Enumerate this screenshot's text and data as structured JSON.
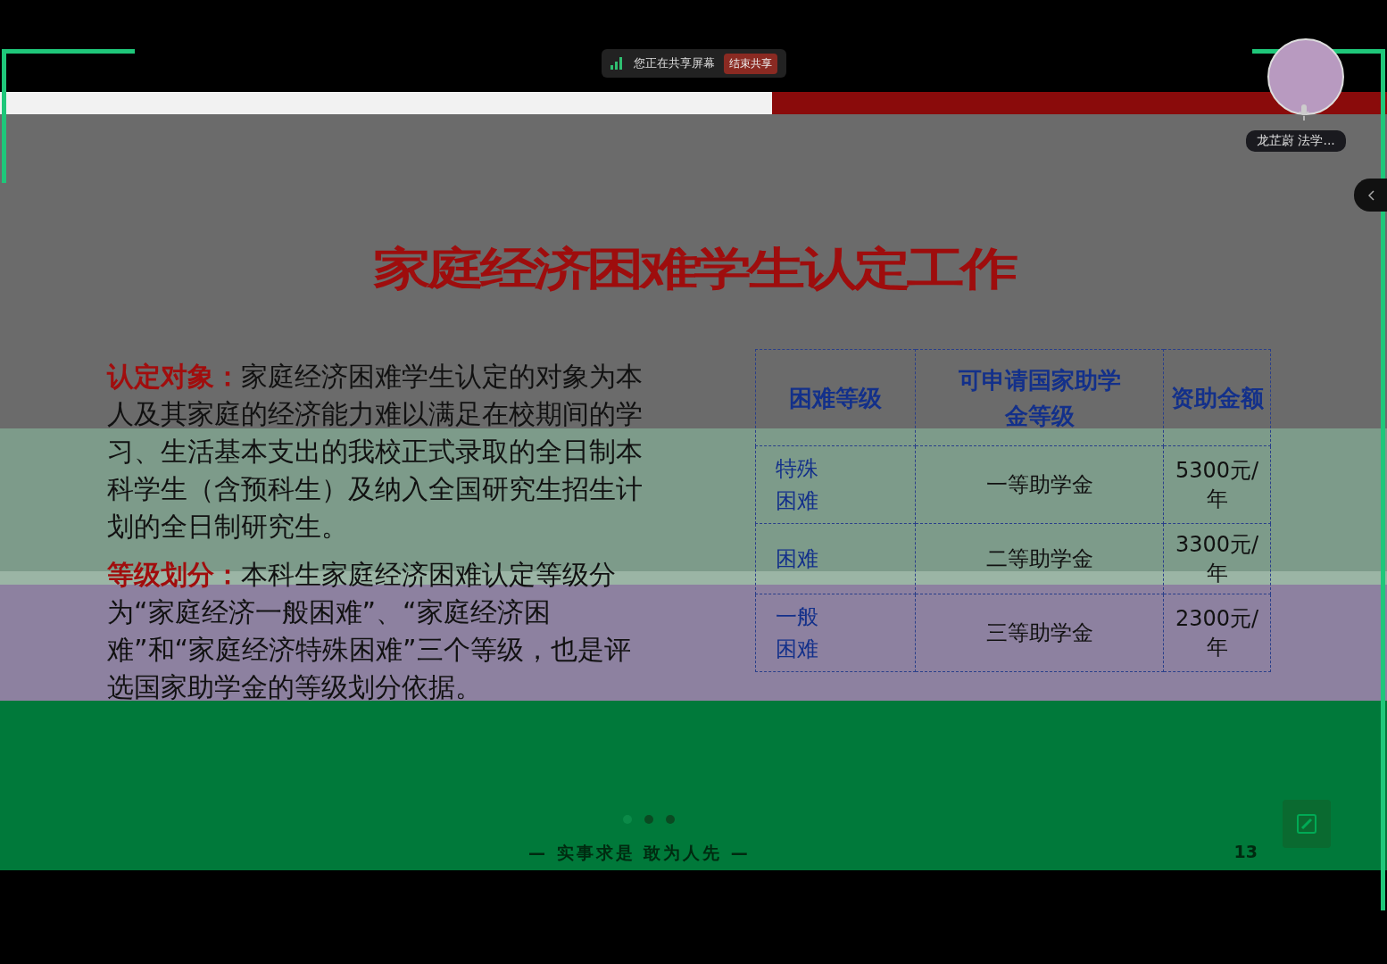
{
  "share_bar": {
    "status": "您正在共享屏幕",
    "stop_button": "结束共享"
  },
  "presenter": {
    "name": "龙芷蔚 法学..."
  },
  "slide": {
    "title": "家庭经济困难学生认定工作",
    "paragraphs": [
      {
        "label": "认定对象：",
        "text": "家庭经济困难学生认定的对象为本人及其家庭的经济能力难以满足在校期间的学习、生活基本支出的我校正式录取的全日制本科学生（含预科生）及纳入全国研究生招生计划的全日制研究生。"
      },
      {
        "label": "等级划分：",
        "text": "本科生家庭经济困难认定等级分为“家庭经济一般困难”、“家庭经济困难”和“家庭经济特殊困难”三个等级，也是评选国家助学金的等级划分依据。"
      }
    ],
    "table": {
      "columns": [
        "困难等级",
        "可申请国家助学金等级",
        "资助金额"
      ],
      "rows": [
        [
          "特殊困难",
          "一等助学金",
          "5300元/年"
        ],
        [
          "困难",
          "二等助学金",
          "3300元/年"
        ],
        [
          "一般困难",
          "三等助学金",
          "2300元/年"
        ]
      ]
    },
    "dots": [
      {
        "selected": true
      },
      {
        "selected": false
      },
      {
        "selected": false
      }
    ],
    "motto": "—  实事求是  敢为人先  —",
    "page_number": "13"
  }
}
